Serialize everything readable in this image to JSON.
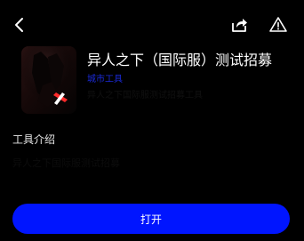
{
  "app": {
    "title": "异人之下（国际服）测试招募",
    "developer": "城市工具",
    "subtitle": "异人之下国际服测试招募工具"
  },
  "section": {
    "title": "工具介绍",
    "description": "异人之下国际服测试招募"
  },
  "actions": {
    "open_label": "打开"
  },
  "icons": {
    "back": "chevron-left-icon",
    "share": "share-icon",
    "report": "warning-triangle-icon"
  },
  "colors": {
    "background": "#000000",
    "accent": "#0015ff",
    "developer_text": "#1a2ad8"
  }
}
